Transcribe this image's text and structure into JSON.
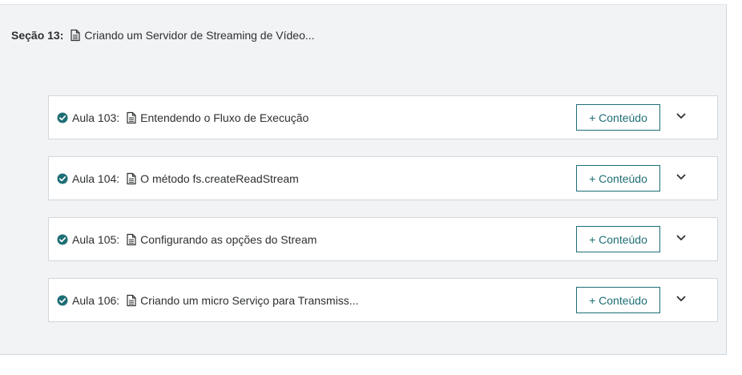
{
  "section": {
    "prefix": "Seção 13:",
    "title": "Criando um Servidor de Streaming de Vídeo..."
  },
  "lessons": [
    {
      "prefix": "Aula 103:",
      "title": "Entendendo o Fluxo de Execução",
      "button_label": "+ Conteúdo",
      "completed": true
    },
    {
      "prefix": "Aula 104:",
      "title": "O método fs.createReadStream",
      "button_label": "+ Conteúdo",
      "completed": true
    },
    {
      "prefix": "Aula 105:",
      "title": "Configurando as opções do Stream",
      "button_label": "+ Conteúdo",
      "completed": true
    },
    {
      "prefix": "Aula 106:",
      "title": "Criando um micro Serviço para Transmiss...",
      "button_label": "+ Conteúdo",
      "completed": true
    }
  ],
  "colors": {
    "accent": "#1e6e75",
    "check": "#1e6e75",
    "text": "#2d2f31",
    "section_bg": "#f2f3f5",
    "border": "#d1d7dc"
  }
}
